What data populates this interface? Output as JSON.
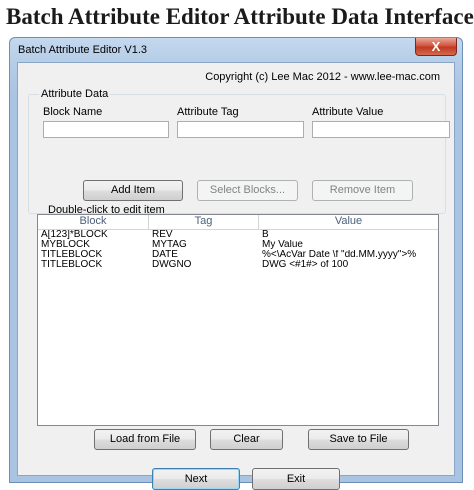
{
  "headline": "Batch Attribute Editor Attribute Data Interface",
  "window": {
    "title": "Batch Attribute Editor V1.3",
    "close_symbol": "X"
  },
  "copyright": "Copyright (c) Lee Mac 2012  -  www.lee-mac.com",
  "attribute_group": {
    "title": "Attribute Data",
    "block_name_label": "Block Name",
    "attribute_tag_label": "Attribute Tag",
    "attribute_value_label": "Attribute Value",
    "block_name_value": "",
    "attribute_tag_value": "",
    "attribute_value_value": "",
    "add_item": "Add Item",
    "select_blocks": "Select Blocks...",
    "remove_item": "Remove Item"
  },
  "list": {
    "caption": "Double-click to edit item",
    "columns": [
      "Block",
      "Tag",
      "Value"
    ],
    "rows": [
      [
        "A[123]*BLOCK",
        "REV",
        "B"
      ],
      [
        "MYBLOCK",
        "MYTAG",
        "My Value"
      ],
      [
        "TITLEBLOCK",
        "DATE",
        "%<\\AcVar Date \\f \"dd.MM.yyyy\">%"
      ],
      [
        "TITLEBLOCK",
        "DWGNO",
        "DWG <#1#> of 100"
      ]
    ]
  },
  "file_buttons": {
    "load": "Load from File",
    "clear": "Clear",
    "save": "Save to File"
  },
  "nav_buttons": {
    "next": "Next",
    "exit": "Exit"
  },
  "colors": {
    "title_bar": "#b3cbe6",
    "close_button": "#c23a22",
    "client_bg": "#f0f0f0",
    "default_button_border": "#3c7fb1"
  }
}
